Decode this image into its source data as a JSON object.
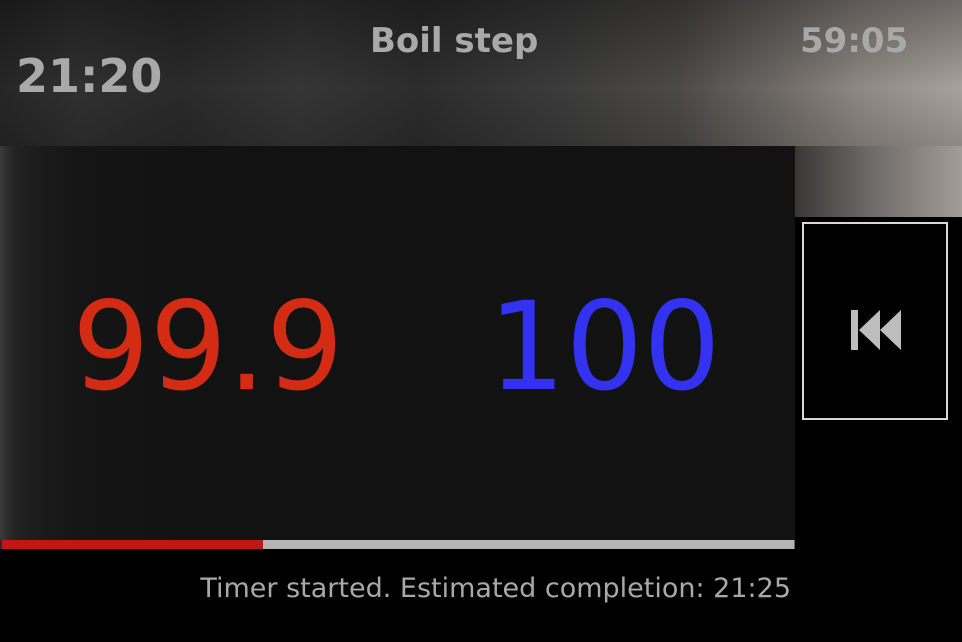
{
  "header": {
    "clock": "21:20",
    "step_title": "Boil step",
    "remaining": "59:05"
  },
  "display": {
    "current_temp": "99.9",
    "target_temp": "100"
  },
  "progress": {
    "fraction": 0.33
  },
  "status": {
    "message": "Timer started. Estimated completion: 21:25"
  },
  "controls": {
    "back_icon": "skip-back-icon"
  },
  "colors": {
    "current_temp": "#d42b14",
    "target_temp": "#3232f0",
    "progress_fill": "#c01616",
    "progress_track": "#b4b4b4",
    "header_text": "#a9a9a9"
  }
}
